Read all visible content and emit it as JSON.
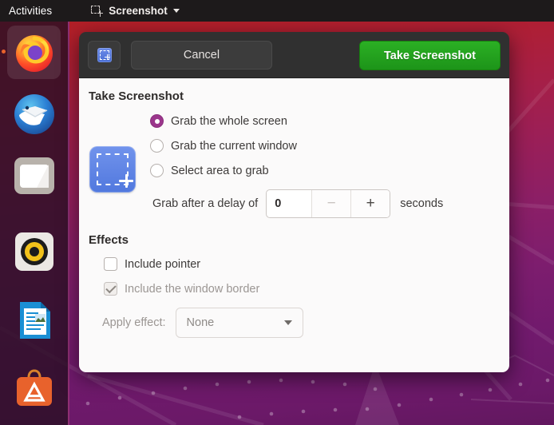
{
  "topbar": {
    "activities": "Activities",
    "app_menu": {
      "icon": "screenshot-dashed-icon",
      "label": "Screenshot",
      "arrow": "chevron-down-icon"
    }
  },
  "dock": {
    "items": [
      {
        "name": "firefox",
        "label": "Firefox",
        "running": true
      },
      {
        "name": "thunderbird",
        "label": "Thunderbird",
        "running": false
      },
      {
        "name": "files",
        "label": "Files",
        "running": false
      },
      {
        "name": "rhythmbox",
        "label": "Rhythmbox",
        "running": false
      },
      {
        "name": "libreoffice-writer",
        "label": "LibreOffice Writer",
        "running": false
      },
      {
        "name": "ubuntu-software",
        "label": "Ubuntu Software",
        "running": false
      }
    ]
  },
  "dialog": {
    "header": {
      "icon": "screenshot-blue-icon",
      "cancel_label": "Cancel",
      "take_label": "Take Screenshot",
      "accent_green": "#1d9419"
    },
    "take_section": {
      "title": "Take Screenshot",
      "mode_icon": "screenshot-area-icon",
      "options": [
        {
          "label": "Grab the whole screen",
          "selected": true
        },
        {
          "label": "Grab the current window",
          "selected": false
        },
        {
          "label": "Select area to grab",
          "selected": false
        }
      ],
      "accent_purple": "#9b368c",
      "delay": {
        "label": "Grab after a delay of",
        "value": "0",
        "decrement": "−",
        "increment": "+",
        "unit": "seconds",
        "decrement_enabled": false,
        "increment_enabled": true
      }
    },
    "effects_section": {
      "title": "Effects",
      "checkboxes": [
        {
          "label": "Include pointer",
          "checked": false,
          "disabled": false
        },
        {
          "label": "Include the window border",
          "checked": true,
          "disabled": true
        }
      ],
      "apply_effect": {
        "label": "Apply effect:",
        "value": "None",
        "arrow": "chevron-down-icon",
        "disabled": true
      }
    }
  }
}
